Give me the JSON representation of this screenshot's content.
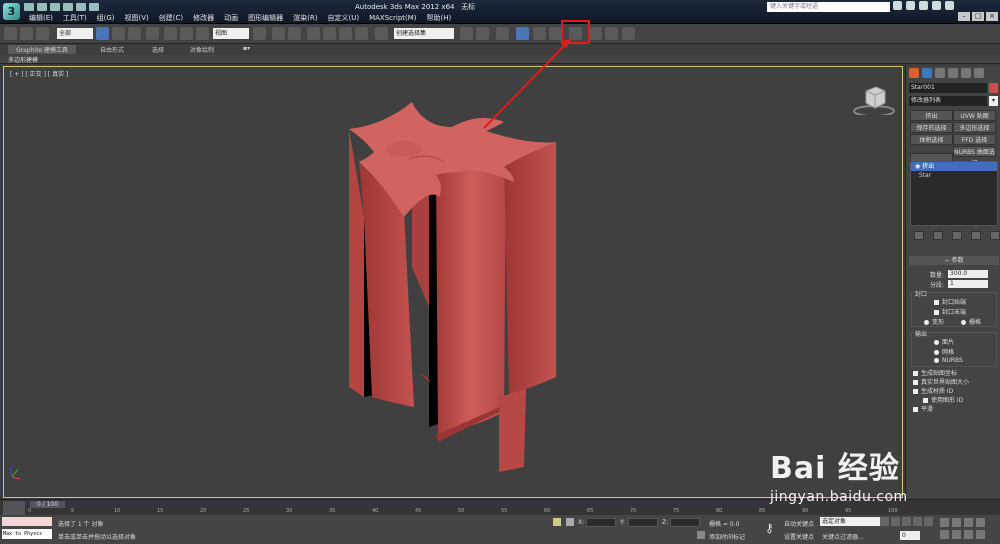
{
  "app": {
    "title": "Autodesk 3ds Max 2012 x64",
    "doc_title": "无标",
    "logo_letter": "3",
    "search_placeholder": "键入关键字或短语"
  },
  "menu": [
    "编辑(E)",
    "工具(T)",
    "组(G)",
    "视图(V)",
    "创建(C)",
    "修改器",
    "动画",
    "图形编辑器",
    "渲染(R)",
    "自定义(U)",
    "MAXScript(M)",
    "帮助(H)"
  ],
  "toolbar": {
    "selection_filter": "全部",
    "ref_coord": "视图",
    "named_selection": "创建选择集"
  },
  "ribbon": {
    "tabs": [
      "Graphite 建模工具",
      "自由形式",
      "选择",
      "对象绘制"
    ],
    "sub_label": "多边形建模"
  },
  "viewport": {
    "label": "[ + ] [ 正交 ] [ 真实 ]",
    "object_color": "#c8504e",
    "border_color": "#d8c26a"
  },
  "command_panel": {
    "object_name": "Star001",
    "modifier_list": "修改器列表",
    "buttons": [
      "挤出",
      "UVW 贴图",
      "保存的选择",
      "多边形选择",
      "体积选择",
      "FFD 选择",
      "",
      "NURBS 曲面选择"
    ],
    "stack": [
      "挤出",
      "Star"
    ],
    "rollout_title": "参数",
    "amount_label": "数量:",
    "amount_value": "300.0",
    "segments_label": "分段:",
    "segments_value": "1",
    "capping_title": "封口",
    "cap_start": "封口始端",
    "cap_end": "封口末端",
    "morph": "变形",
    "grid": "栅格",
    "output_title": "输出",
    "out_patch": "面片",
    "out_mesh": "网格",
    "out_nurbs": "NURBS",
    "gen_map": "生成贴图坐标",
    "real_world": "真实世界贴图大小",
    "gen_matid": "生成材质 ID",
    "use_shape_id": "使用图形 ID",
    "smooth": "平滑"
  },
  "timeline": {
    "slider": "0 / 100",
    "ticks": [
      "0",
      "5",
      "10",
      "15",
      "20",
      "25",
      "30",
      "35",
      "40",
      "45",
      "50",
      "55",
      "60",
      "65",
      "70",
      "75",
      "80",
      "85",
      "90",
      "95",
      "100"
    ]
  },
  "status": {
    "maxscript_text": "Max to Physcs",
    "line1": "选择了 1 个 对象",
    "line2": "单击或单击并拖动以选择对象",
    "x_label": "X:",
    "y_label": "Y:",
    "z_label": "Z:",
    "grid": "栅格 = 0.0",
    "add_time_tag": "添加时间标记",
    "auto_key": "自动关键点",
    "selected_object": "选定对象",
    "set_key": "设置关键点",
    "key_filters": "关键点过滤器...",
    "frame": "0"
  },
  "watermark": {
    "line1": "Bai 经验",
    "line2": "jingyan.baidu.com"
  },
  "annotation": {
    "highlight_color": "#e21b1b"
  }
}
